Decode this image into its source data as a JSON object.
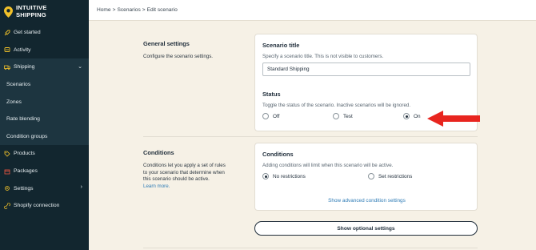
{
  "brand": {
    "line1": "INTUITIVE",
    "line2": "SHIPPING",
    "pin_color": "#f1c12a"
  },
  "sidebar": {
    "items": [
      {
        "label": "Get started",
        "icon": "rocket-icon"
      },
      {
        "label": "Activity",
        "icon": "activity-icon"
      },
      {
        "label": "Shipping",
        "icon": "truck-icon",
        "expanded": true
      },
      {
        "label": "Scenarios",
        "sub": true
      },
      {
        "label": "Zones",
        "sub": true
      },
      {
        "label": "Rate blending",
        "sub": true
      },
      {
        "label": "Condition groups",
        "sub": true
      },
      {
        "label": "Products",
        "icon": "tag-icon"
      },
      {
        "label": "Packages",
        "icon": "package-icon"
      },
      {
        "label": "Settings",
        "icon": "gear-icon"
      },
      {
        "label": "Shopify connection",
        "icon": "link-icon"
      }
    ]
  },
  "breadcrumb": {
    "home": "Home",
    "scenarios": "Scenarios",
    "current": "Edit scenario",
    "sep": ">"
  },
  "general": {
    "title": "General settings",
    "desc": "Configure the scenario settings."
  },
  "scenario_card": {
    "title": "Scenario title",
    "hint": "Specify a scenario title. This is not visible to customers.",
    "value": "Standard Shipping",
    "status_title": "Status",
    "status_hint": "Toggle the status of the scenario. Inactive scenarios will be ignored.",
    "options": [
      "Off",
      "Test",
      "On"
    ],
    "selected": "On"
  },
  "conditions": {
    "title": "Conditions",
    "desc_line1": "Conditions let you apply a set of rules",
    "desc_line2": "to your scenario that determine when",
    "desc_line3": "this scenario should be active.",
    "learn_more": "Learn more."
  },
  "conditions_card": {
    "title": "Conditions",
    "hint": "Adding conditions will limit when this scenario will be active.",
    "options": [
      "No restrictions",
      "Set restrictions"
    ],
    "selected": "No restrictions",
    "advanced_link": "Show advanced condition settings"
  },
  "optional_button": "Show optional settings",
  "colors": {
    "sidebar_bg": "#12262f",
    "page_bg": "#f6f1e6",
    "link": "#2f7cb6",
    "arrow": "#e8251f"
  }
}
